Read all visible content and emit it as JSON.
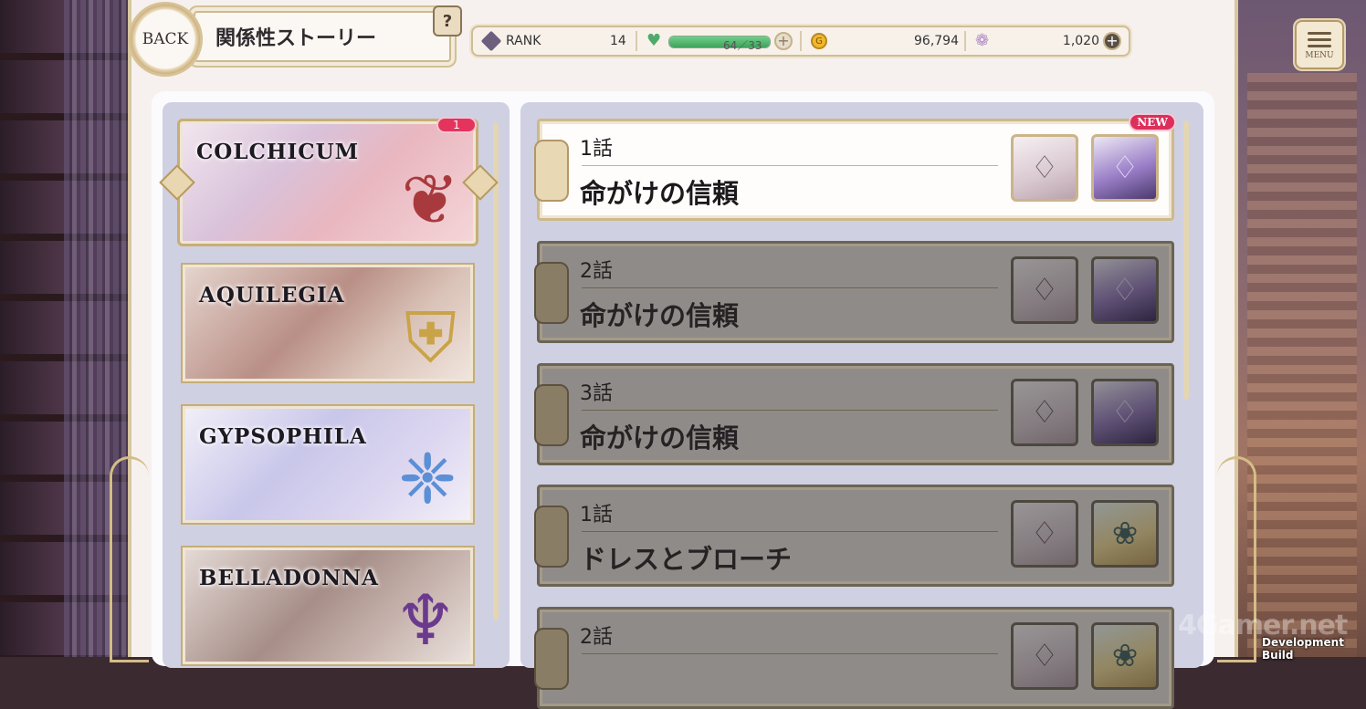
{
  "header": {
    "back_label": "BACK",
    "title": "関係性ストーリー",
    "help_label": "?",
    "menu_label": "MENU"
  },
  "status": {
    "rank_label": "RANK",
    "rank_value": "14",
    "stamina_text": "64／33",
    "stamina_fraction": 1.0,
    "coin_value": "96,794",
    "coin_symbol": "G",
    "gem_value": "1,020",
    "plus_symbol": "+"
  },
  "categories": [
    {
      "name": "COLCHICUM",
      "badge": "1",
      "emblem": "❦",
      "emblem_color": "#a83a3e",
      "bg": "linear-gradient(135deg,#f2e7ef 0%,#d9c2da 35%,#e9b7bf 60%,#f4d6d8 100%)"
    },
    {
      "name": "AQUILEGIA",
      "emblem": "⛨",
      "emblem_color": "#c9a347",
      "bg": "linear-gradient(135deg,#e6d6cf 0%,#b98f86 45%,#d9c1b6 70%,#f1e6df 100%)"
    },
    {
      "name": "GYPSOPHILA",
      "emblem": "❈",
      "emblem_color": "#5b8fd6",
      "bg": "linear-gradient(135deg,#f3f0f8 0%,#c9c7ea 40%,#dcd6f0 70%,#f4f1f9 100%)"
    },
    {
      "name": "BELLADONNA",
      "emblem": "♆",
      "emblem_color": "#6b3a8e",
      "bg": "linear-gradient(135deg,#e6dcd8 0%,#a78e88 45%,#c7b3ad 70%,#ece3df 100%)"
    }
  ],
  "episodes": [
    {
      "num": "1話",
      "title": "命がけの信頼",
      "state": "active",
      "new": "NEW",
      "portraits": [
        "white",
        "purple"
      ]
    },
    {
      "num": "2話",
      "title": "命がけの信頼",
      "state": "locked",
      "portraits": [
        "white",
        "purple"
      ]
    },
    {
      "num": "3話",
      "title": "命がけの信頼",
      "state": "locked",
      "portraits": [
        "white",
        "purple"
      ]
    },
    {
      "num": "1話",
      "title": "ドレスとブローチ",
      "state": "locked",
      "portraits": [
        "white",
        "blonde"
      ]
    },
    {
      "num": "2話",
      "title": "",
      "state": "locked",
      "portraits": [
        "white",
        "blonde"
      ]
    }
  ],
  "footer": {
    "watermark": "4Gamer.net",
    "dev_build": "Development Build"
  },
  "colors": {
    "accent_gold": "#cdb98a",
    "badge_red": "#dc2f5b",
    "panel_lavender": "#cfd0e2",
    "stamina_green": "#4faa6d"
  }
}
